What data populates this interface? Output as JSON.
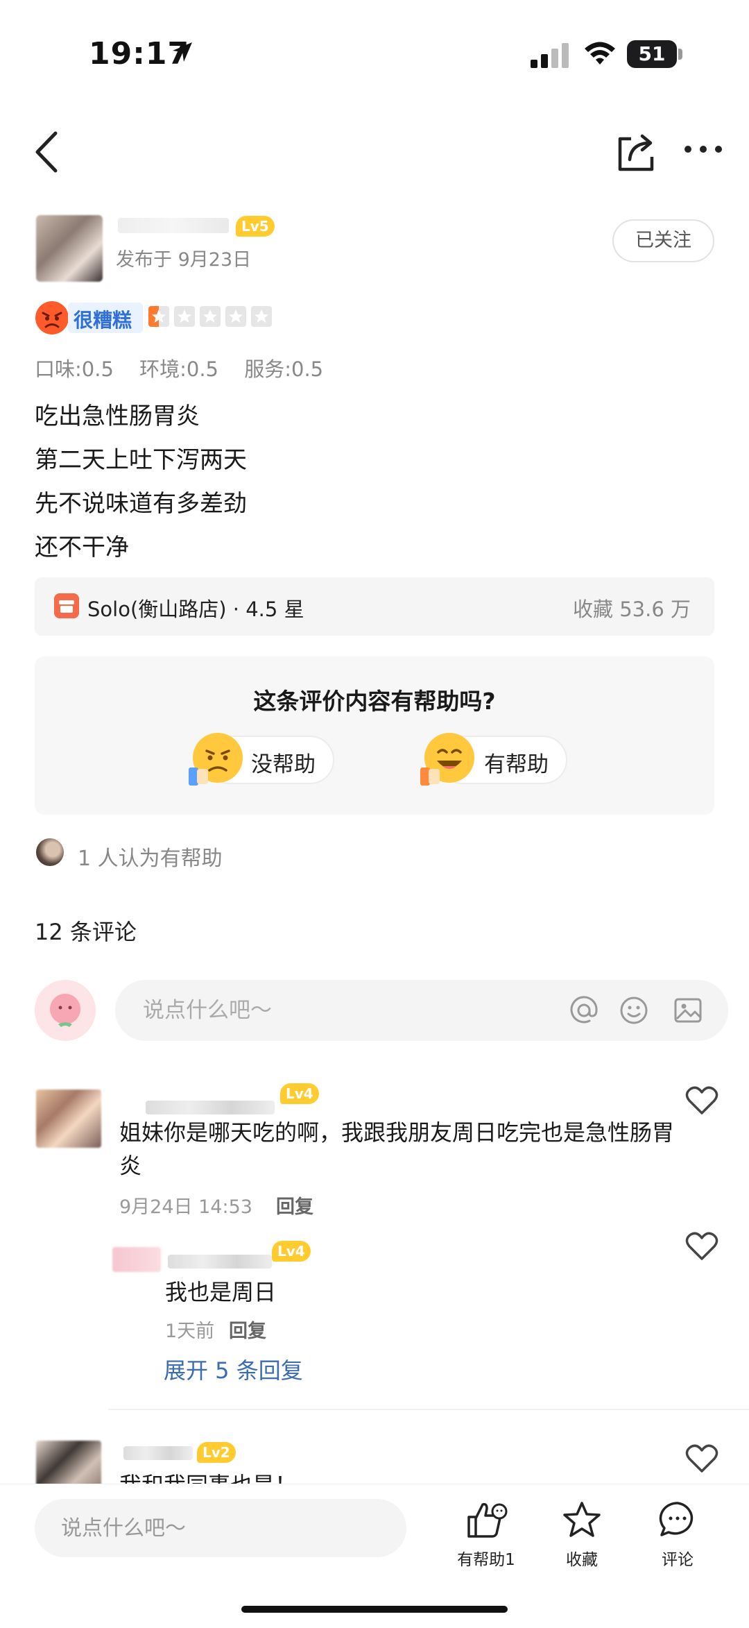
{
  "status_bar": {
    "time": "19:17",
    "battery": "51"
  },
  "author": {
    "level": "Lv5",
    "posted": "发布于 9月23日",
    "follow_label": "已关注"
  },
  "rating": {
    "label": "很糟糕",
    "stars": 0.5,
    "max_stars": 5
  },
  "sub_scores": [
    "口味:0.5",
    "环境:0.5",
    "服务:0.5"
  ],
  "review_lines": [
    "吃出急性肠胃炎",
    "第二天上吐下泻两天",
    "先不说味道有多差劲",
    "还不干净"
  ],
  "shop": {
    "name": "Solo(衡山路店) · 4.5 星",
    "favorites": "收藏 53.6 万"
  },
  "helpful": {
    "question": "这条评价内容有帮助吗?",
    "no_label": "没帮助",
    "yes_label": "有帮助",
    "summary": "1 人认为有帮助"
  },
  "comments_header": "12 条评论",
  "comment_input": {
    "placeholder": "说点什么吧～"
  },
  "comments": [
    {
      "level": "Lv4",
      "text": "姐妹你是哪天吃的啊，我跟我朋友周日吃完也是急性肠胃炎",
      "date": "9月24日  14:53",
      "reply_label": "回复"
    },
    {
      "level": "Lv4",
      "text": "我也是周日",
      "date": "1天前",
      "reply_label": "回复",
      "expand_label": "展开 5 条回复"
    },
    {
      "level": "Lv2",
      "text": "我和我同事也是！"
    }
  ],
  "bottom_bar": {
    "placeholder": "说点什么吧～",
    "helpful_label": "有帮助1",
    "favorite_label": "收藏",
    "comment_label": "评论"
  },
  "icons": [
    "back-icon",
    "share-icon",
    "more-icon",
    "at-icon",
    "emoji-icon",
    "image-icon",
    "heart-icon",
    "thumbs-up-icon",
    "star-icon",
    "comment-icon"
  ],
  "colors": {
    "accent_blue": "#3a6bb5",
    "level_badge": "#ffcb2f",
    "rating_orange": "#ff7a2f"
  }
}
